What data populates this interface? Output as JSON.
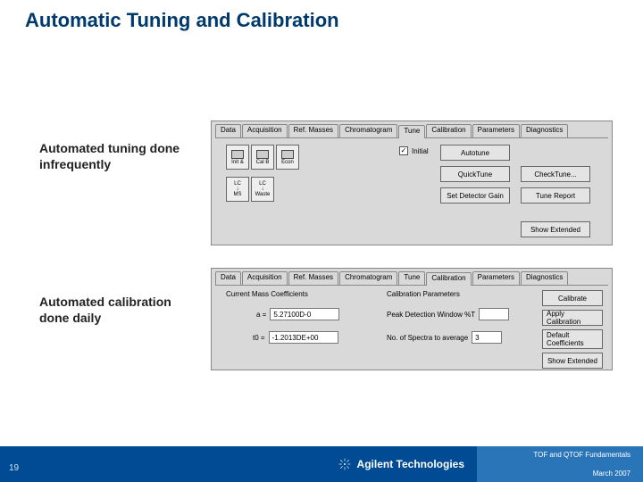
{
  "title": "Automatic Tuning and Calibration",
  "captions": {
    "tuning": "Automated tuning done infrequently",
    "calibration": "Automated calibration done daily"
  },
  "panel1": {
    "tabs": [
      "Data",
      "Acquisition",
      "Ref. Masses",
      "Chromatogram",
      "Tune",
      "Calibration",
      "Parameters",
      "Diagnostics"
    ],
    "active_tab_index": 4,
    "tools_row1": [
      "Init &",
      "Cal B",
      "Econ"
    ],
    "tools_row2": [
      "LC",
      "LC"
    ],
    "tools_row2_sub": [
      "↓",
      "↓"
    ],
    "tools_row2_cap": [
      "MS",
      "Waste"
    ],
    "checkbox": {
      "checked": true,
      "label": "Initial"
    },
    "buttons": {
      "autotune": "Autotune",
      "quicktune": "QuickTune",
      "checktune": "CheckTune...",
      "set_detector_gain": "Set Detector Gain",
      "tune_report": "Tune Report",
      "show_extended": "Show Extended"
    }
  },
  "panel2": {
    "tabs": [
      "Data",
      "Acquisition",
      "Ref. Masses",
      "Chromatogram",
      "Tune",
      "Calibration",
      "Parameters",
      "Diagnostics"
    ],
    "active_tab_index": 5,
    "left_header": "Current Mass Coefficients",
    "right_header": "Calibration Parameters",
    "a_label": "a =",
    "a_value": "5.27100D-0",
    "t0_label": "t0 =",
    "t0_value": "-1.2013DE+00",
    "peak_label": "Peak Detection Window %T",
    "peak_value": "",
    "spectra_label": "No. of Spectra to average",
    "spectra_value": "3",
    "buttons": {
      "calibrate": "Calibrate",
      "apply_calibration": "Apply Calibration",
      "default_coefficients": "Default Coefficients",
      "show_extended": "Show Extended"
    }
  },
  "footer": {
    "page_number": "19",
    "brand": "Agilent Technologies",
    "line1": "TOF and QTOF Fundamentals",
    "line2": "March 2007"
  }
}
